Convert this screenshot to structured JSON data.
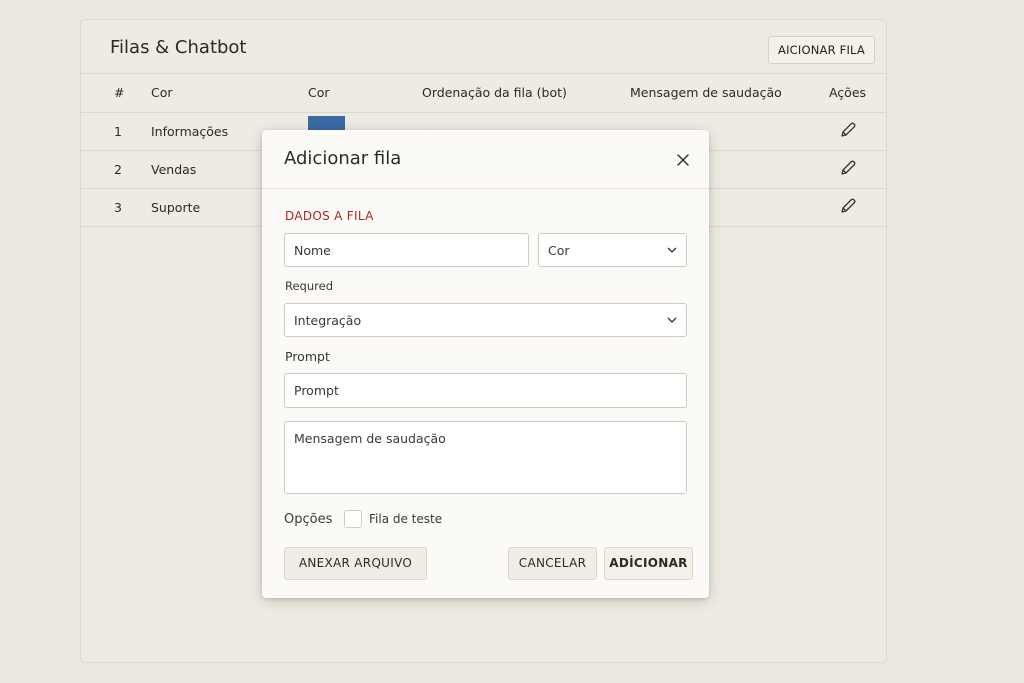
{
  "page": {
    "title": "Filas & Chatbot",
    "add_button": "AICIONAR FILA"
  },
  "table": {
    "headers": [
      "#",
      "Cor",
      "Cor",
      "Ordenação da fila (bot)",
      "Mensagem de saudação",
      "Ações"
    ],
    "rows": [
      {
        "num": "1",
        "name": "Informações",
        "color": "#3a6aa3",
        "order": "‹"
      },
      {
        "num": "2",
        "name": "Vendas"
      },
      {
        "num": "3",
        "name": "Suporte"
      }
    ]
  },
  "modal": {
    "title": "Adicionar fila",
    "section_label": "DADOS A FILA",
    "name_placeholder": "Nome",
    "color_select": "Cor",
    "required_label": "Requred",
    "integration_select": "Integração",
    "prompt_label": "Prompt",
    "prompt_placeholder": "Prompt",
    "greeting_placeholder": "Mensagem de saudação",
    "options_label": "Opções",
    "test_queue_label": "Fila de teste",
    "attach_button": "ANEXAR ARQUIVO",
    "cancel_button": "CANCELAR",
    "add_button": "ADİCIONAR"
  },
  "icons": {
    "edit": "pencil-icon",
    "close": "close-icon",
    "dropdown": "chevron-down-icon"
  },
  "colors": {
    "background": "#ece8df",
    "accent_red": "#a32a2a",
    "swatch_blue": "#3a6aa3"
  }
}
